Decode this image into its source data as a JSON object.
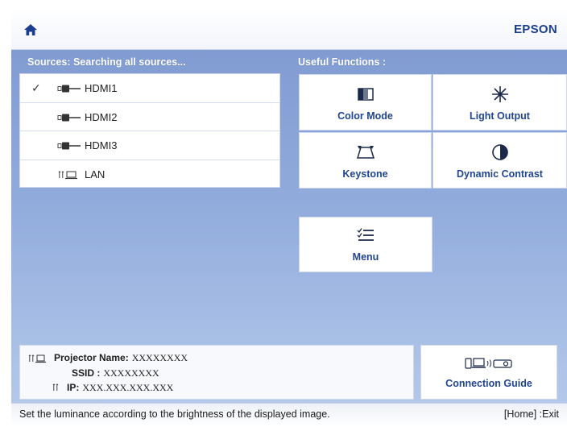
{
  "header": {
    "brand": "EPSON",
    "home_icon": "home-icon"
  },
  "sources": {
    "title": "Sources:  Searching all sources...",
    "items": [
      {
        "label": "HDMI1",
        "icon": "hdmi-icon",
        "selected": true
      },
      {
        "label": "HDMI2",
        "icon": "hdmi-icon",
        "selected": false
      },
      {
        "label": "HDMI3",
        "icon": "hdmi-icon",
        "selected": false
      },
      {
        "label": "LAN",
        "icon": "lan-icon",
        "selected": false
      }
    ],
    "check_glyph": "✓"
  },
  "functions": {
    "title": "Useful Functions :",
    "tiles": [
      {
        "label": "Color Mode",
        "icon": "color-mode-icon"
      },
      {
        "label": "Light Output",
        "icon": "light-output-icon"
      },
      {
        "label": "Keystone",
        "icon": "keystone-icon"
      },
      {
        "label": "Dynamic Contrast",
        "icon": "dynamic-contrast-icon"
      }
    ],
    "menu": {
      "label": "Menu",
      "icon": "menu-icon"
    }
  },
  "info": {
    "projector_name_label": "Projector Name:",
    "projector_name_value": "XXXXXXXX",
    "ssid_label": "SSID :",
    "ssid_value": "XXXXXXXX",
    "ip_label": "IP:",
    "ip_value": "XXX.XXX.XXX.XXX"
  },
  "connection_guide": {
    "label": "Connection Guide",
    "icon": "connection-guide-icon"
  },
  "status": {
    "text": "Set the luminance according to the brightness of the displayed image.",
    "exit": "[Home] :Exit"
  },
  "colors": {
    "accent": "#21458f",
    "brand": "#1b3f8f",
    "background": "#90aadb"
  }
}
